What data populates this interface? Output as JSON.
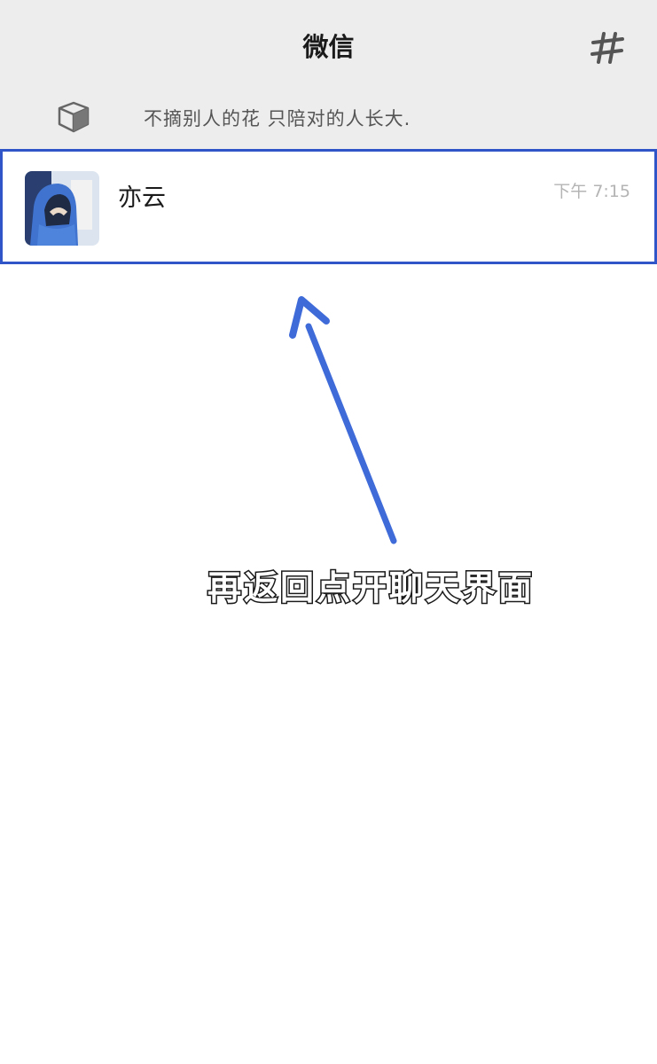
{
  "header": {
    "title": "微信",
    "right_icon": "hash-icon"
  },
  "status": {
    "icon": "cube-status-icon",
    "text": "不摘别人的花 只陪对的人长大."
  },
  "chat_list": [
    {
      "name": "亦云",
      "time": "下午 7:15",
      "avatar": "avatar-hooded-figure"
    }
  ],
  "annotation": {
    "caption": "再返回点开聊天界面",
    "arrow_icon": "arrow-up-icon"
  },
  "colors": {
    "highlight_border": "#2f55c8",
    "arrow": "#3f6bd9",
    "header_bg": "#ededed"
  }
}
